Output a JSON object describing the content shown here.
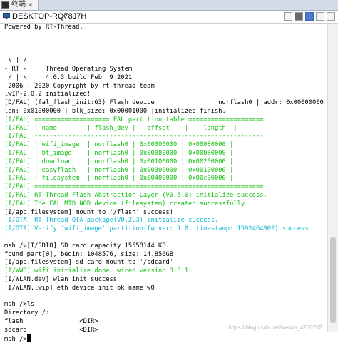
{
  "tab": {
    "label": "终端"
  },
  "title": {
    "label": "DESKTOP-RQ78J7H",
    "close": "✕"
  },
  "colors": {
    "fal": "#11c011",
    "ota": "#11b7d6",
    "text": "#000000"
  },
  "terminal": {
    "lines": [
      {
        "text": "Powered by RT-Thread.",
        "color": "default"
      },
      {
        "text": "",
        "color": "default"
      },
      {
        "text": "",
        "color": "default"
      },
      {
        "text": "",
        "color": "default"
      },
      {
        "text": " \\ | /",
        "color": "default"
      },
      {
        "text": "- RT -     Thread Operating System",
        "color": "default"
      },
      {
        "text": " / | \\     4.0.3 build Feb  9 2021",
        "color": "default"
      },
      {
        "text": " 2006 - 2020 Copyright by rt-thread team",
        "color": "default"
      },
      {
        "text": "lwIP-2.0.2 initialized!",
        "color": "default"
      },
      {
        "text": "[D/FAL] (fal_flash_init:63) Flash device |               norflash0 | addr: 0x00000000 |",
        "color": "default"
      },
      {
        "text": "len: 0x01000000 | blk_size: 0x00001000 |initialized finish.",
        "color": "default"
      },
      {
        "text": "[I/FAL] ==================== FAL partition table ====================",
        "color": "green"
      },
      {
        "text": "[I/FAL] | name        | flash_dev |   offset    |    length  |",
        "color": "green"
      },
      {
        "text": "[I/FAL] -------------------------------------------------------------",
        "color": "green"
      },
      {
        "text": "[I/FAL] | wifi_image  | norflash0 | 0x00000000 | 0x00080000 |",
        "color": "green"
      },
      {
        "text": "[I/FAL] | bt_image    | norflash0 | 0x00080000 | 0x00080000 |",
        "color": "green"
      },
      {
        "text": "[I/FAL] | download    | norflash0 | 0x00100000 | 0x00200000 |",
        "color": "green"
      },
      {
        "text": "[I/FAL] | easyflash   | norflash0 | 0x00300000 | 0x00100000 |",
        "color": "green"
      },
      {
        "text": "[I/FAL] | filesystem  | norflash0 | 0x00400000 | 0x00c00000 |",
        "color": "green"
      },
      {
        "text": "[I/FAL] =============================================================",
        "color": "green"
      },
      {
        "text": "[I/FAL] RT-Thread Flash Abstraction Layer (V0.5.0) initialize success.",
        "color": "green"
      },
      {
        "text": "[I/FAL] The FAL MTD NOR device (filesystem) created successfully",
        "color": "green"
      },
      {
        "text": "[I/app.filesystem] mount to '/flash' success!",
        "color": "default"
      },
      {
        "text": "[I/OTA] RT-Thread OTA package(V0.2.3) initialize success.",
        "color": "cyan"
      },
      {
        "text": "[I/OTA] Verify 'wifi_image' partition(fw ver: 1.0, timestamp: 1592464902) success",
        "color": "cyan"
      },
      {
        "text": ".",
        "color": "cyan"
      },
      {
        "text": "msh />[I/SDIO] SD card capacity 15558144 KB.",
        "color": "default"
      },
      {
        "text": "found part[0], begin: 1048576, size: 14.856GB",
        "color": "default"
      },
      {
        "text": "[I/app.filesystem] sd card mount to '/sdcard'",
        "color": "default"
      },
      {
        "text": "[I/WWD] wifi initialize done. wiced version 3.3.1",
        "color": "green"
      },
      {
        "text": "[I/WLAN.dev] wlan init success",
        "color": "default"
      },
      {
        "text": "[I/WLAN.lwip] eth device init ok name:w0",
        "color": "default"
      },
      {
        "text": "",
        "color": "default"
      },
      {
        "text": "msh />ls",
        "color": "default"
      },
      {
        "text": "Directory /:",
        "color": "default"
      },
      {
        "text": "flash               <DIR>",
        "color": "default"
      },
      {
        "text": "sdcard              <DIR>",
        "color": "default"
      }
    ],
    "prompt": "msh />"
  },
  "watermark": "https://blog.csdn.net/weixin_4280702"
}
